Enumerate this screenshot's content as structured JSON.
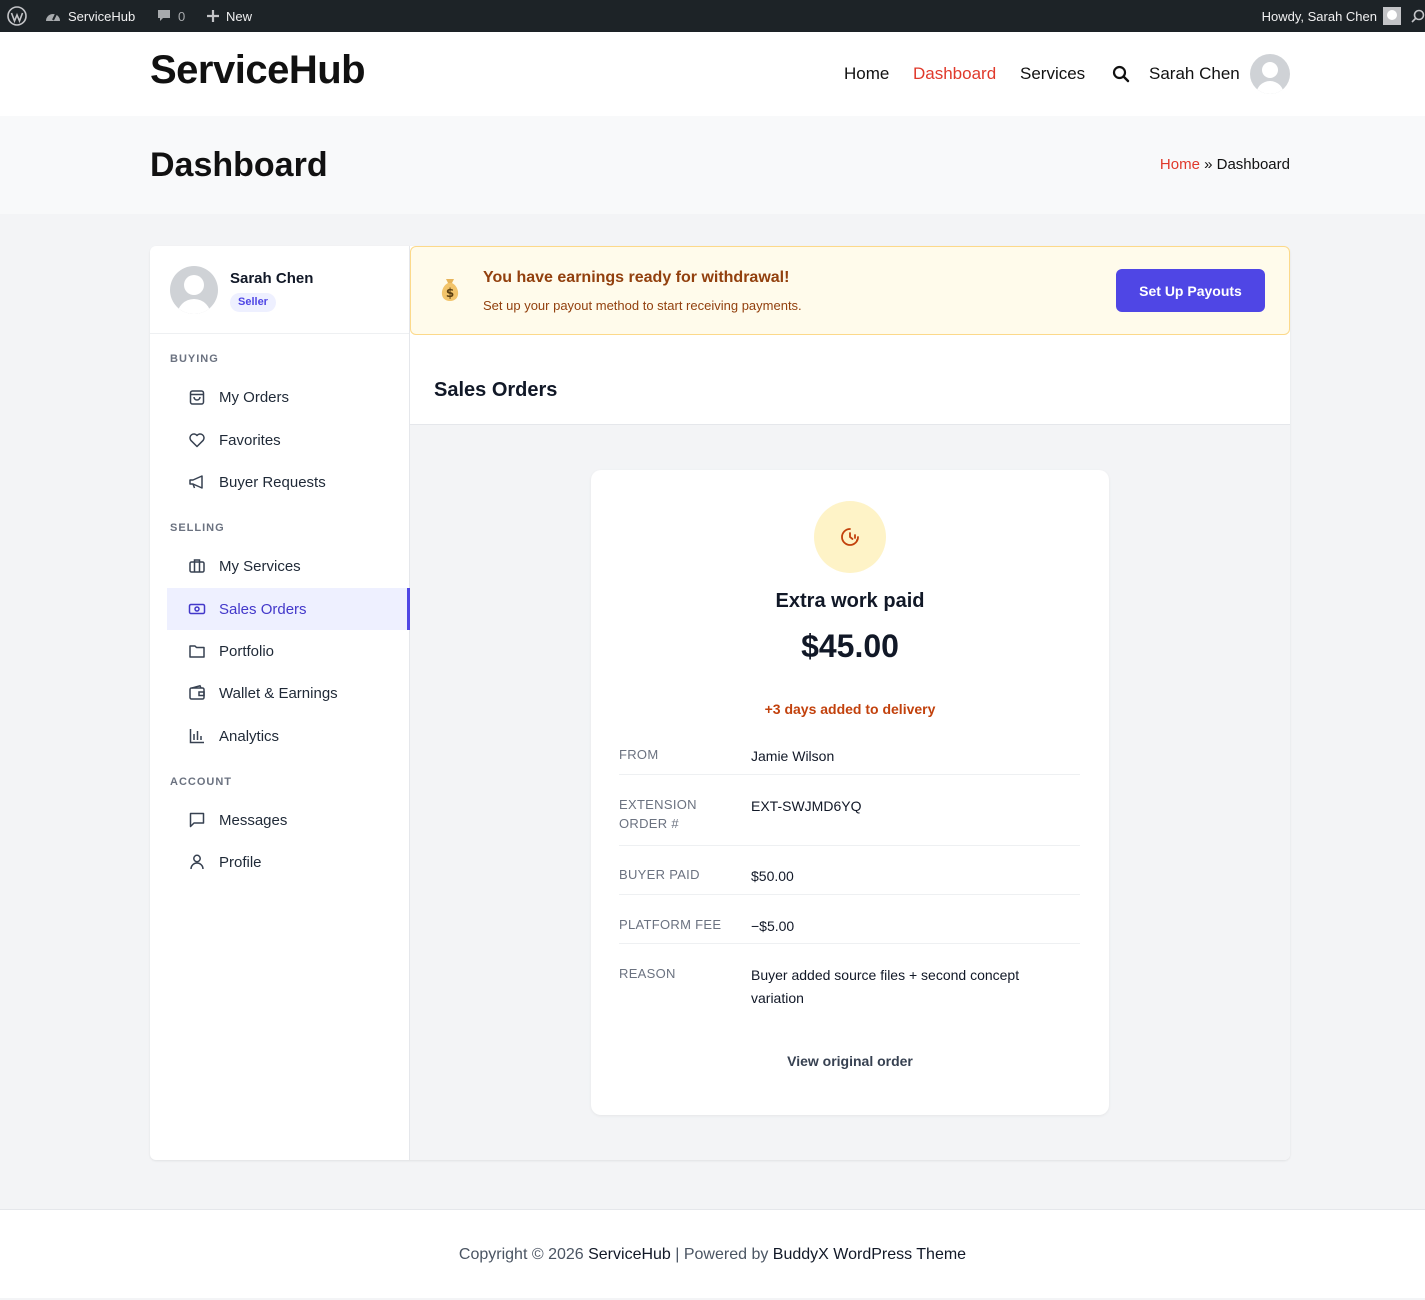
{
  "adminbar": {
    "site_name": "ServiceHub",
    "comments_count": "0",
    "new_label": "New",
    "howdy": "Howdy, Sarah Chen"
  },
  "header": {
    "logo": "ServiceHub",
    "nav": {
      "home": "Home",
      "dashboard": "Dashboard",
      "services": "Services"
    },
    "user_name": "Sarah Chen"
  },
  "titlebar": {
    "title": "Dashboard",
    "breadcrumb": {
      "home": "Home",
      "separator": "»",
      "current": "Dashboard"
    }
  },
  "sidebar": {
    "user_name": "Sarah Chen",
    "user_role": "Seller",
    "sections": {
      "buying": "BUYING",
      "selling": "SELLING",
      "account": "ACCOUNT"
    },
    "items": {
      "my_orders": "My Orders",
      "favorites": "Favorites",
      "buyer_requests": "Buyer Requests",
      "my_services": "My Services",
      "sales_orders": "Sales Orders",
      "portfolio": "Portfolio",
      "wallet": "Wallet & Earnings",
      "analytics": "Analytics",
      "messages": "Messages",
      "profile": "Profile"
    },
    "active_item": "sales_orders"
  },
  "alert": {
    "icon": "money-bag-icon",
    "title": "You have earnings ready for withdrawal!",
    "subtitle": "Set up your payout method to start receiving payments.",
    "button": "Set Up Payouts"
  },
  "main": {
    "section_title": "Sales Orders",
    "card": {
      "icon": "clock-icon",
      "title": "Extra work paid",
      "amount": "$45.00",
      "delivery_note": "+3 days added to delivery",
      "details": {
        "from_label": "FROM",
        "from_value": "Jamie Wilson",
        "ext_label": "EXTENSION ORDER #",
        "ext_value": "EXT-SWJMD6YQ",
        "paid_label": "BUYER PAID",
        "paid_value": "$50.00",
        "fee_label": "PLATFORM FEE",
        "fee_value": "−$5.00",
        "reason_label": "REASON",
        "reason_value": "Buyer added source files + second concept variation"
      },
      "link": "View original order"
    }
  },
  "footer": {
    "prefix": "Copyright © 2026 ",
    "site": "ServiceHub",
    "middle": " | Powered by ",
    "theme": "BuddyX WordPress Theme"
  },
  "colors": {
    "accent": "#4f46e5",
    "nav_active": "#e0392b",
    "alert_bg": "#fffbeb",
    "alert_text": "#92400e",
    "delay_text": "#c2410c"
  }
}
